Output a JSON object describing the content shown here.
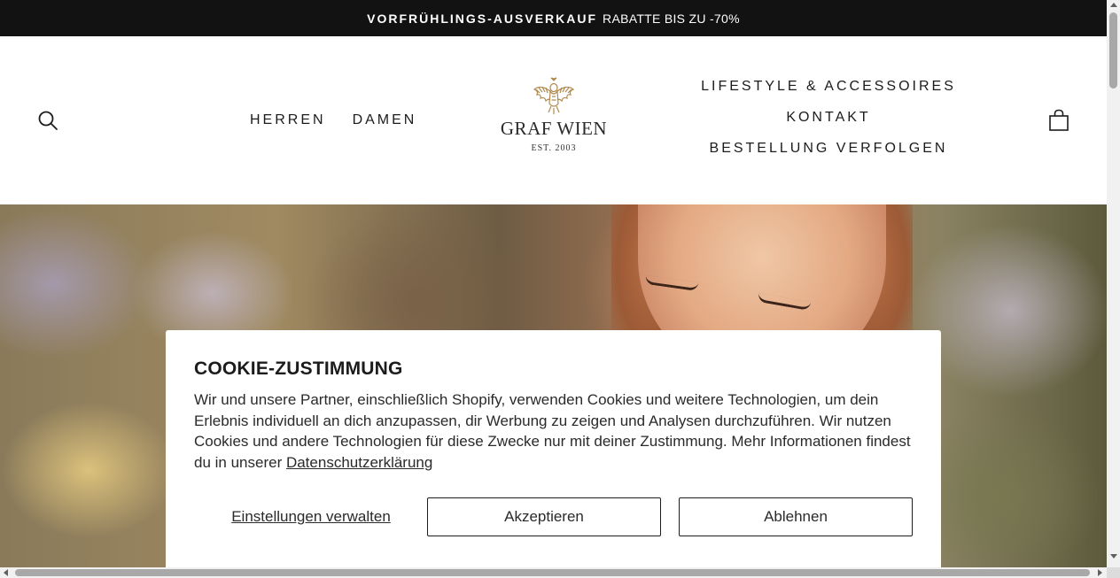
{
  "announcement": {
    "highlight": "VORFRÜHLINGS-AUSVERKAUF",
    "text": "RABATTE BIS ZU -70%"
  },
  "header": {
    "nav_left": [
      "HERREN",
      "DAMEN"
    ],
    "nav_right": [
      "LIFESTYLE & ACCESSOIRES",
      "KONTAKT",
      "BESTELLUNG VERFOLGEN"
    ],
    "logo": {
      "name": "GRAF WIEN",
      "est": "EST. 2003"
    },
    "icons": {
      "search": "search-icon",
      "cart": "shopping-bag-icon"
    }
  },
  "cookie_banner": {
    "title": "COOKIE-ZUSTIMMUNG",
    "body": "Wir und unsere Partner, einschließlich Shopify, verwenden Cookies und weitere Technologien, um dein Erlebnis individuell an dich anzupassen, dir Werbung zu zeigen und Analysen durchzuführen. Wir nutzen Cookies und andere Technologien für diese Zwecke nur mit deiner Zustimmung. Mehr Informationen findest du in unserer ",
    "privacy_link": "Datenschutzerklärung",
    "manage_label": "Einstellungen verwalten",
    "accept_label": "Akzeptieren",
    "decline_label": "Ablehnen"
  },
  "colors": {
    "announcement_bg": "#121212",
    "text": "#1c1c1c",
    "logo_gold": "#b08a4e"
  }
}
